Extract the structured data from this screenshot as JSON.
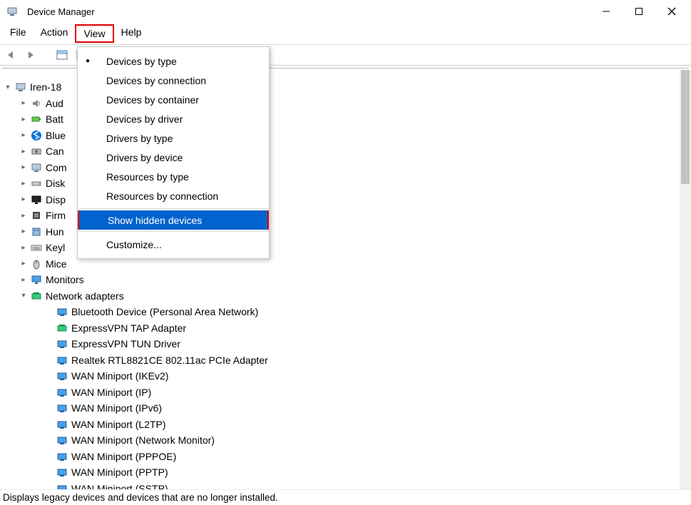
{
  "window": {
    "title": "Device Manager"
  },
  "menubar": {
    "file": "File",
    "action": "Action",
    "view": "View",
    "help": "Help"
  },
  "dropdown": {
    "devicesByType": "Devices by type",
    "devicesByConnection": "Devices by connection",
    "devicesByContainer": "Devices by container",
    "devicesByDriver": "Devices by driver",
    "driversByType": "Drivers by type",
    "driversByDevice": "Drivers by device",
    "resourcesByType": "Resources by type",
    "resourcesByConnection": "Resources by connection",
    "showHidden": "Show hidden devices",
    "customize": "Customize..."
  },
  "tree": {
    "root": "Iren-18",
    "items": [
      {
        "label": "Aud",
        "icon": "speaker"
      },
      {
        "label": "Batt",
        "icon": "battery"
      },
      {
        "label": "Blue",
        "icon": "bluetooth"
      },
      {
        "label": "Can",
        "icon": "camera"
      },
      {
        "label": "Com",
        "icon": "computer"
      },
      {
        "label": "Disk",
        "icon": "disk"
      },
      {
        "label": "Disp",
        "icon": "display"
      },
      {
        "label": "Firm",
        "icon": "firmware"
      },
      {
        "label": "Hun",
        "icon": "hid"
      },
      {
        "label": "Keyl",
        "icon": "keyboard"
      },
      {
        "label": "Mice",
        "icon": "mouse"
      }
    ],
    "monitors": "Monitors",
    "network": "Network adapters",
    "networkItems": [
      "Bluetooth Device (Personal Area Network)",
      "ExpressVPN TAP Adapter",
      "ExpressVPN TUN Driver",
      "Realtek RTL8821CE 802.11ac PCIe Adapter",
      "WAN Miniport (IKEv2)",
      "WAN Miniport (IP)",
      "WAN Miniport (IPv6)",
      "WAN Miniport (L2TP)",
      "WAN Miniport (Network Monitor)",
      "WAN Miniport (PPPOE)",
      "WAN Miniport (PPTP)",
      "WAN Miniport (SSTP)"
    ]
  },
  "status": "Displays legacy devices and devices that are no longer installed."
}
